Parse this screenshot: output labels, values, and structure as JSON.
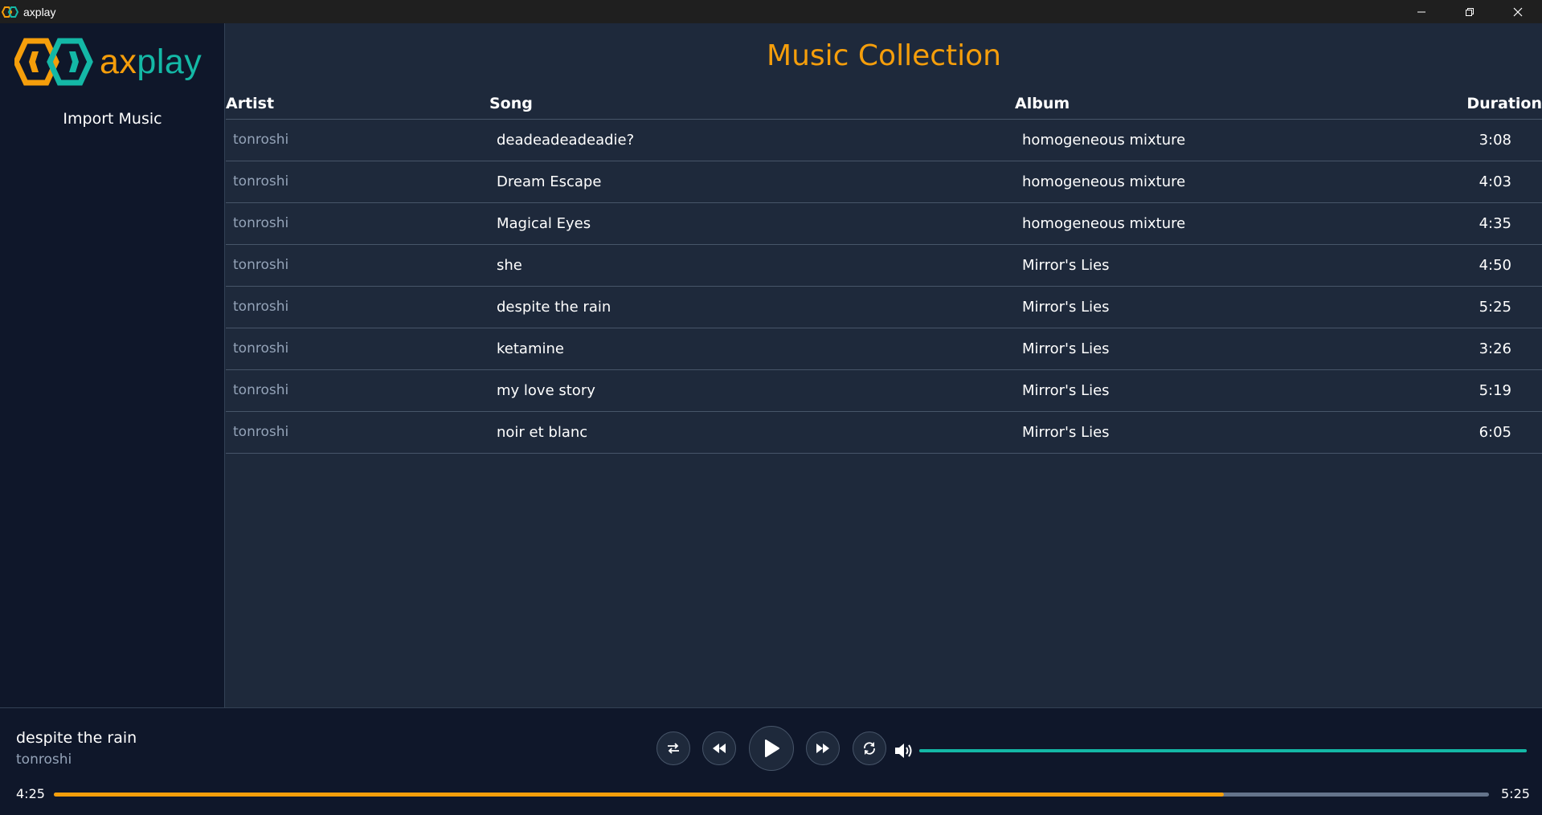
{
  "window": {
    "title": "axplay",
    "icon": "axplay-logo-icon",
    "controls": [
      "minimize-icon",
      "restore-icon",
      "close-icon"
    ]
  },
  "sidebar": {
    "logo_text_prefix": "ax",
    "logo_text_suffix": "play",
    "import_label": "Import Music"
  },
  "main": {
    "title": "Music Collection",
    "columns": {
      "artist": "Artist",
      "song": "Song",
      "album": "Album",
      "duration": "Duration"
    },
    "tracks": [
      {
        "artist": "tonroshi",
        "song": "deadeadeadeadie?",
        "album": "homogeneous mixture",
        "duration": "3:08"
      },
      {
        "artist": "tonroshi",
        "song": "Dream Escape",
        "album": "homogeneous mixture",
        "duration": "4:03"
      },
      {
        "artist": "tonroshi",
        "song": "Magical Eyes",
        "album": "homogeneous mixture",
        "duration": "4:35"
      },
      {
        "artist": "tonroshi",
        "song": "she",
        "album": "Mirror's Lies",
        "duration": "4:50"
      },
      {
        "artist": "tonroshi",
        "song": "despite the rain",
        "album": "Mirror's Lies",
        "duration": "5:25"
      },
      {
        "artist": "tonroshi",
        "song": "ketamine",
        "album": "Mirror's Lies",
        "duration": "3:26"
      },
      {
        "artist": "tonroshi",
        "song": "my love story",
        "album": "Mirror's Lies",
        "duration": "5:19"
      },
      {
        "artist": "tonroshi",
        "song": "noir et blanc",
        "album": "Mirror's Lies",
        "duration": "6:05"
      }
    ]
  },
  "player": {
    "now_playing_title": "despite the rain",
    "now_playing_artist": "tonroshi",
    "current_time": "4:25",
    "total_time": "5:25",
    "progress_fraction": 0.815,
    "volume_fraction": 1.0,
    "controls": [
      "shuffle-icon",
      "previous-icon",
      "play-icon",
      "next-icon",
      "repeat-icon",
      "volume-icon"
    ]
  },
  "colors": {
    "accent_orange": "#f59e0b",
    "accent_teal": "#14b8a6",
    "background": "#1e293b",
    "sidebar_bg": "#0f172a"
  }
}
